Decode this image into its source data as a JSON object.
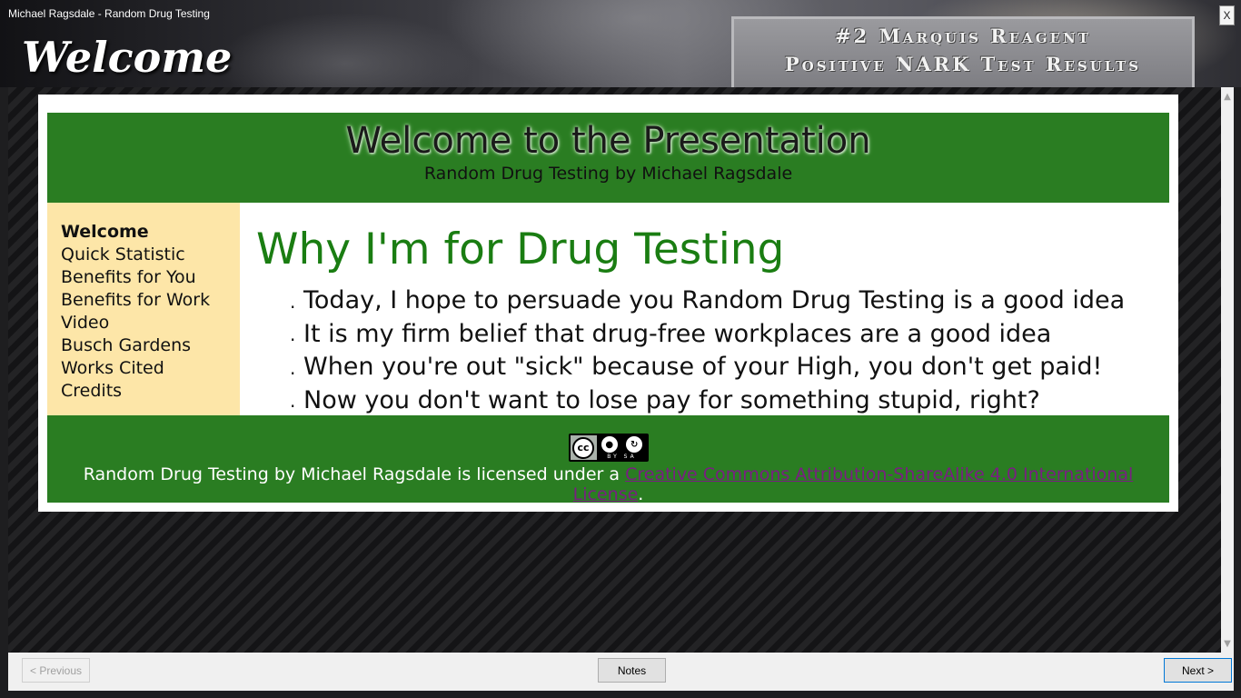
{
  "window": {
    "title": "Michael Ragsdale - Random Drug Testing",
    "close_label": "X"
  },
  "page": {
    "heading": "Welcome",
    "banner_line1": "#2 Marquis Reagent",
    "banner_line2": "Positive NARK Test Results"
  },
  "slide": {
    "header": {
      "title": "Welcome to the Presentation",
      "subtitle": "Random Drug Testing by Michael Ragsdale"
    },
    "nav": [
      {
        "label": "Welcome",
        "active": true
      },
      {
        "label": "Quick Statistic",
        "active": false
      },
      {
        "label": "Benefits for You",
        "active": false
      },
      {
        "label": "Benefits for Work",
        "active": false
      },
      {
        "label": "Video",
        "active": false
      },
      {
        "label": "Busch Gardens",
        "active": false
      },
      {
        "label": "Works Cited",
        "active": false
      },
      {
        "label": "Credits",
        "active": false
      }
    ],
    "main": {
      "heading": "Why I'm for Drug Testing",
      "bullets": [
        "Today, I hope to persuade you Random Drug Testing is a good idea",
        "It is my firm belief that drug-free workplaces are a good idea",
        "When you're out \"sick\" because of your High, you don't get paid!",
        "Now you don't want to lose pay for something stupid, right?"
      ]
    },
    "footer": {
      "badge_cc": "cc",
      "badge_by": "BY",
      "badge_sa": "SA",
      "license_prefix": "Random Drug Testing by Michael Ragsdale is licensed under a ",
      "license_link": "Creative Commons Attribution-ShareAlike 4.0 International License",
      "license_suffix": "."
    }
  },
  "toolbar": {
    "previous_label": "< Previous",
    "notes_label": "Notes",
    "next_label": "Next >"
  },
  "colors": {
    "header_green": "#2a7d22",
    "sidebar_yellow": "#fde6a8",
    "heading_green": "#1a7d12",
    "link_purple": "#7a1e82"
  }
}
